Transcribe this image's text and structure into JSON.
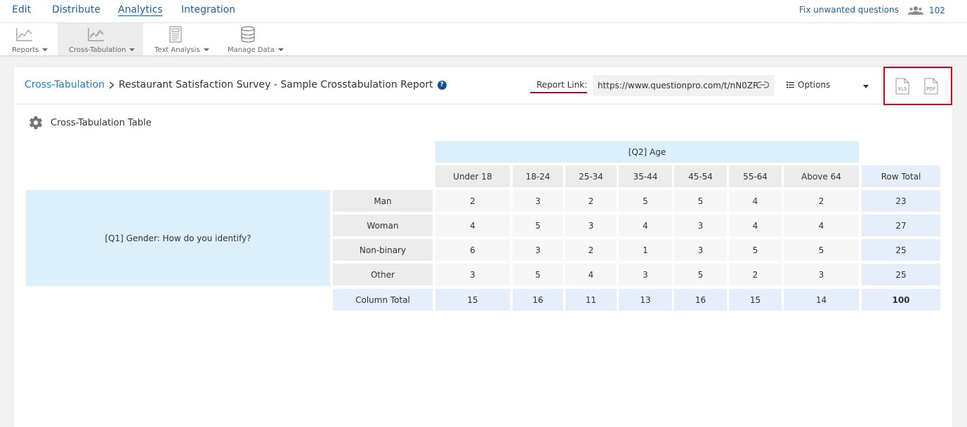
{
  "nav": {
    "items": [
      {
        "label": "Edit",
        "active": false
      },
      {
        "label": "Distribute",
        "active": false
      },
      {
        "label": "Analytics",
        "active": true
      },
      {
        "label": "Integration",
        "active": false
      }
    ],
    "fix_link": "Fix unwanted questions",
    "user_count": "102",
    "accent_color": "#1d5fa8"
  },
  "toolbar": {
    "items": [
      {
        "label": "Reports",
        "icon": "line-chart-icon",
        "active": false
      },
      {
        "label": "Cross-Tabulation",
        "icon": "cross-tab-chart-icon",
        "active": true
      },
      {
        "label": "Text Analysis",
        "icon": "text-document-icon",
        "active": false
      },
      {
        "label": "Manage Data",
        "icon": "database-icon",
        "active": false
      }
    ]
  },
  "header": {
    "breadcrumb_link": "Cross-Tabulation",
    "breadcrumb_title": "Restaurant Satisfaction Survey - Sample Crosstabulation Report",
    "report_link_label": "Report Link:",
    "report_url": "https://www.questionpro.com/t/nN0ZR",
    "options_label": "Options",
    "export_xls": "XLS",
    "export_pdf": "PDF",
    "highlight_color": "#d0021b"
  },
  "section": {
    "title": "Cross-Tabulation Table"
  },
  "crosstab": {
    "column_question": "[Q2] Age",
    "row_question": "[Q1] Gender: How do you identify?",
    "columns": [
      "Under 18",
      "18-24",
      "25-34",
      "35-44",
      "45-54",
      "55-64",
      "Above 64"
    ],
    "row_total_label": "Row Total",
    "rows": [
      {
        "label": "Man",
        "values": [
          "2",
          "3",
          "2",
          "5",
          "5",
          "4",
          "2"
        ],
        "total": "23"
      },
      {
        "label": "Woman",
        "values": [
          "4",
          "5",
          "3",
          "4",
          "3",
          "4",
          "4"
        ],
        "total": "27"
      },
      {
        "label": "Non-binary",
        "values": [
          "6",
          "3",
          "2",
          "1",
          "3",
          "5",
          "5"
        ],
        "total": "25"
      },
      {
        "label": "Other",
        "values": [
          "3",
          "5",
          "4",
          "3",
          "5",
          "2",
          "3"
        ],
        "total": "25"
      }
    ],
    "column_total_label": "Column Total",
    "column_totals": [
      "15",
      "16",
      "11",
      "13",
      "16",
      "15",
      "14"
    ],
    "grand_total": "100"
  }
}
